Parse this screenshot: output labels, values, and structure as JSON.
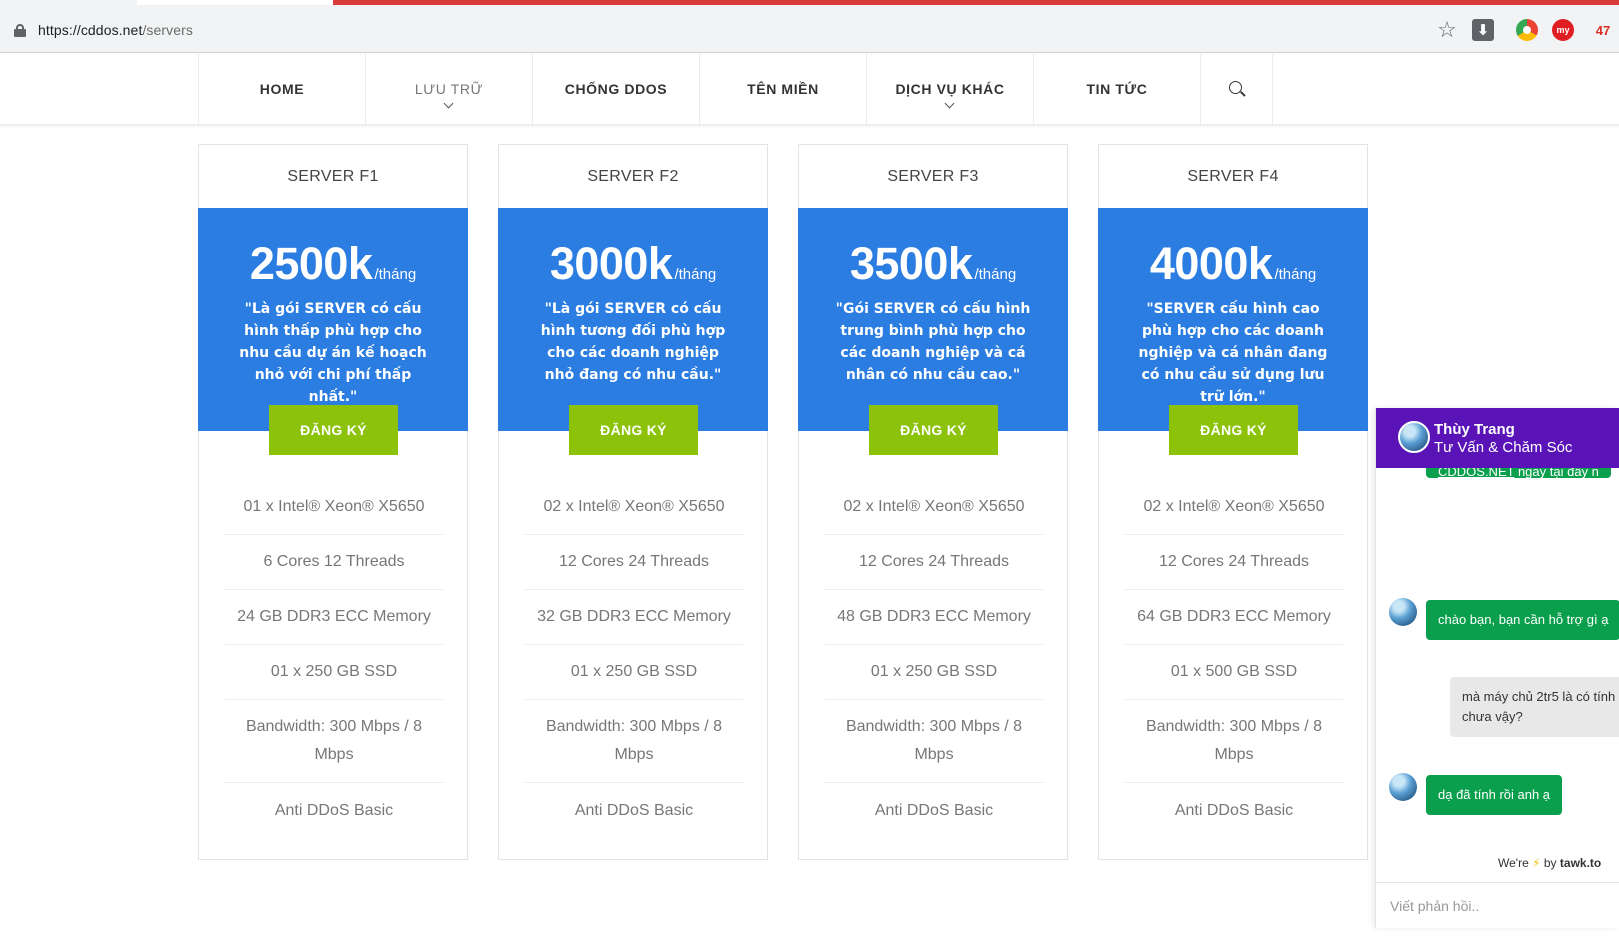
{
  "browser": {
    "url_host": "https://cddos.net",
    "url_path": "/servers",
    "extension_badge": "47",
    "ext2_label": "my"
  },
  "nav": {
    "items": [
      {
        "label": "HOME"
      },
      {
        "label": "LƯU TRỮ"
      },
      {
        "label": "CHỐNG DDOS"
      },
      {
        "label": "TÊN MIỀN"
      },
      {
        "label": "DỊCH VỤ KHÁC"
      },
      {
        "label": "TIN TỨC"
      }
    ]
  },
  "plans": [
    {
      "name": "SERVER F1",
      "price": "2500k",
      "unit": "/tháng",
      "desc": "\"Là gói SERVER có cấu hình thấp phù hợp cho nhu cầu dự án kế hoạch nhỏ với chi phí thấp nhất.\"",
      "button": "ĐĂNG KÝ",
      "features": [
        "01 x Intel® Xeon® X5650",
        "6 Cores 12 Threads",
        "24 GB DDR3 ECC Memory",
        "01 x 250 GB SSD",
        "Bandwidth: 300 Mbps / 8 Mbps",
        "Anti DDoS Basic"
      ]
    },
    {
      "name": "SERVER F2",
      "price": "3000k",
      "unit": "/tháng",
      "desc": "\"Là gói SERVER có cấu hình tương đối phù hợp cho các doanh nghiệp nhỏ đang có nhu cầu.\"",
      "button": "ĐĂNG KÝ",
      "features": [
        "02 x Intel® Xeon® X5650",
        "12 Cores 24 Threads",
        "32 GB DDR3 ECC Memory",
        "01 x 250 GB SSD",
        "Bandwidth: 300 Mbps / 8 Mbps",
        "Anti DDoS Basic"
      ]
    },
    {
      "name": "SERVER F3",
      "price": "3500k",
      "unit": "/tháng",
      "desc": "\"Gói SERVER có cấu hình trung bình phù hợp cho các doanh nghiệp và cá nhân có nhu cầu cao.\"",
      "button": "ĐĂNG KÝ",
      "features": [
        "02 x Intel® Xeon® X5650",
        "12 Cores 24 Threads",
        "48 GB DDR3 ECC Memory",
        "01 x 250 GB SSD",
        "Bandwidth: 300 Mbps / 8 Mbps",
        "Anti DDoS Basic"
      ]
    },
    {
      "name": "SERVER F4",
      "price": "4000k",
      "unit": "/tháng",
      "desc": "\"SERVER cấu hình cao phù hợp cho các doanh nghiệp và cá nhân đang có nhu cầu sử dụng lưu trữ lớn.\"",
      "button": "ĐĂNG KÝ",
      "features": [
        "02 x Intel® Xeon® X5650",
        "12 Cores 24 Threads",
        "64 GB DDR3 ECC Memory",
        "01 x 500 GB SSD",
        "Bandwidth: 300 Mbps / 8 Mbps",
        "Anti DDoS Basic"
      ]
    }
  ],
  "chat": {
    "agent_name": "Thùy Trang",
    "agent_role": "Tư Vấn & Chăm Sóc",
    "partial_link": "CDDOS.NET",
    "partial_text": " ngay tại đây n",
    "messages": [
      {
        "from": "agent",
        "text": "chào bạn, bạn cần hỗ trợ gì ạ"
      },
      {
        "from": "visitor",
        "text": "mà máy chủ 2tr5 là có tính chưa vậy?"
      },
      {
        "from": "agent",
        "text": "dạ đã tính rồi anh ạ"
      }
    ],
    "powered_prefix": "We're",
    "powered_by": "by",
    "powered_brand": "tawk.to",
    "reply_placeholder": "Viết phản hồi.."
  },
  "colors": {
    "card_blue": "#2b7de1",
    "button_green": "#8cc20a",
    "chat_header": "#5a13b7",
    "chat_green": "#0a9f4c"
  }
}
